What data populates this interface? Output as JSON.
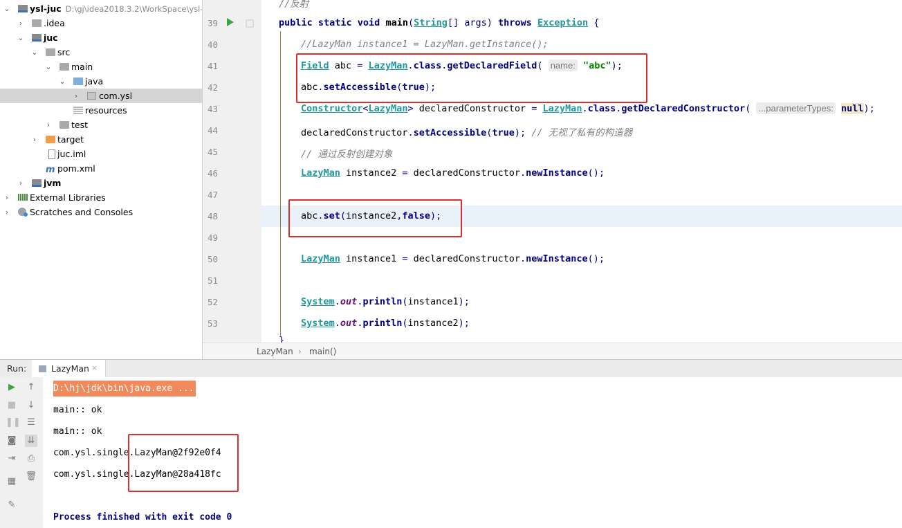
{
  "project_tree": {
    "root": {
      "name": "ysl-juc",
      "path": "D:\\gj\\idea2018.3.2\\WorkSpace\\ysl-"
    },
    "items": [
      {
        "label": ".idea"
      },
      {
        "label": "juc"
      },
      {
        "label": "src"
      },
      {
        "label": "main"
      },
      {
        "label": "java"
      },
      {
        "label": "com.ysl"
      },
      {
        "label": "resources"
      },
      {
        "label": "test"
      },
      {
        "label": "target"
      },
      {
        "label": "juc.iml"
      },
      {
        "label": "pom.xml"
      },
      {
        "label": "jvm"
      },
      {
        "label": "External Libraries"
      },
      {
        "label": "Scratches and Consoles"
      }
    ]
  },
  "editor": {
    "line_numbers": [
      "39",
      "40",
      "41",
      "42",
      "43",
      "44",
      "45",
      "46",
      "47",
      "48",
      "49",
      "50",
      "51",
      "52",
      "53"
    ],
    "top_partial_comment": "//反射",
    "hints": {
      "name": "name:",
      "param_types": "...parameterTypes:"
    },
    "string_abc": "\"abc\"",
    "comment_ignore_private": "// 无视了私有的构造器",
    "comment_reflection_create": "// 通过反射创建对象"
  },
  "breadcrumb": {
    "class_name": "LazyMan",
    "method": "main()"
  },
  "run_panel": {
    "label": "Run:",
    "tab": "LazyMan",
    "console_lines": [
      "D:\\hj\\jdk\\bin\\java.exe ...",
      "main:: ok",
      "main:: ok",
      "com.ysl.single.LazyMan@2f92e0f4",
      "com.ysl.single.LazyMan@28a418fc",
      "",
      "Process finished with exit code 0"
    ]
  },
  "colors": {
    "highlight_box": "#e02d2d",
    "command_line_bg": "#f08a5d",
    "current_line": "#e9f1fb"
  }
}
